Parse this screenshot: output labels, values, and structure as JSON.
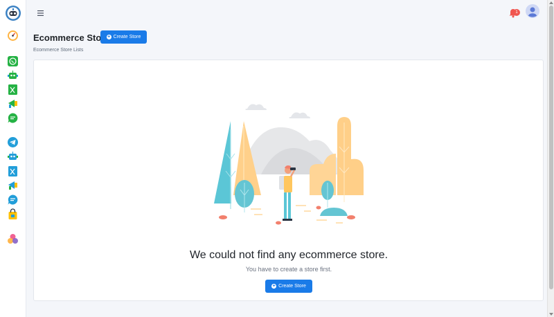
{
  "page": {
    "title": "Ecommerce Store",
    "breadcrumb": "Ecommerce Store Lists"
  },
  "header": {
    "create_button_label": "Create Store"
  },
  "topbar": {
    "notification_count": "1"
  },
  "empty_state": {
    "title": "We could not find any ecommerce store.",
    "subtitle": "You have to create a store first.",
    "button_label": "Create Store"
  },
  "sidebar": {
    "items": [
      {
        "icon": "dashboard-gauge-icon"
      },
      {
        "icon": "whatsapp-icon"
      },
      {
        "icon": "whatsapp-bot-icon"
      },
      {
        "icon": "whatsapp-sheet-icon"
      },
      {
        "icon": "whatsapp-broadcast-icon"
      },
      {
        "icon": "whatsapp-message-icon"
      },
      {
        "icon": "telegram-icon"
      },
      {
        "icon": "telegram-bot-icon"
      },
      {
        "icon": "telegram-sheet-icon"
      },
      {
        "icon": "telegram-broadcast-icon"
      },
      {
        "icon": "telegram-message-icon"
      },
      {
        "icon": "ecommerce-bag-icon"
      },
      {
        "icon": "social-circles-icon"
      }
    ]
  },
  "colors": {
    "primary": "#1a7be8",
    "whatsapp": "#25b244",
    "telegram": "#229ed9",
    "badge": "#f0554f"
  }
}
